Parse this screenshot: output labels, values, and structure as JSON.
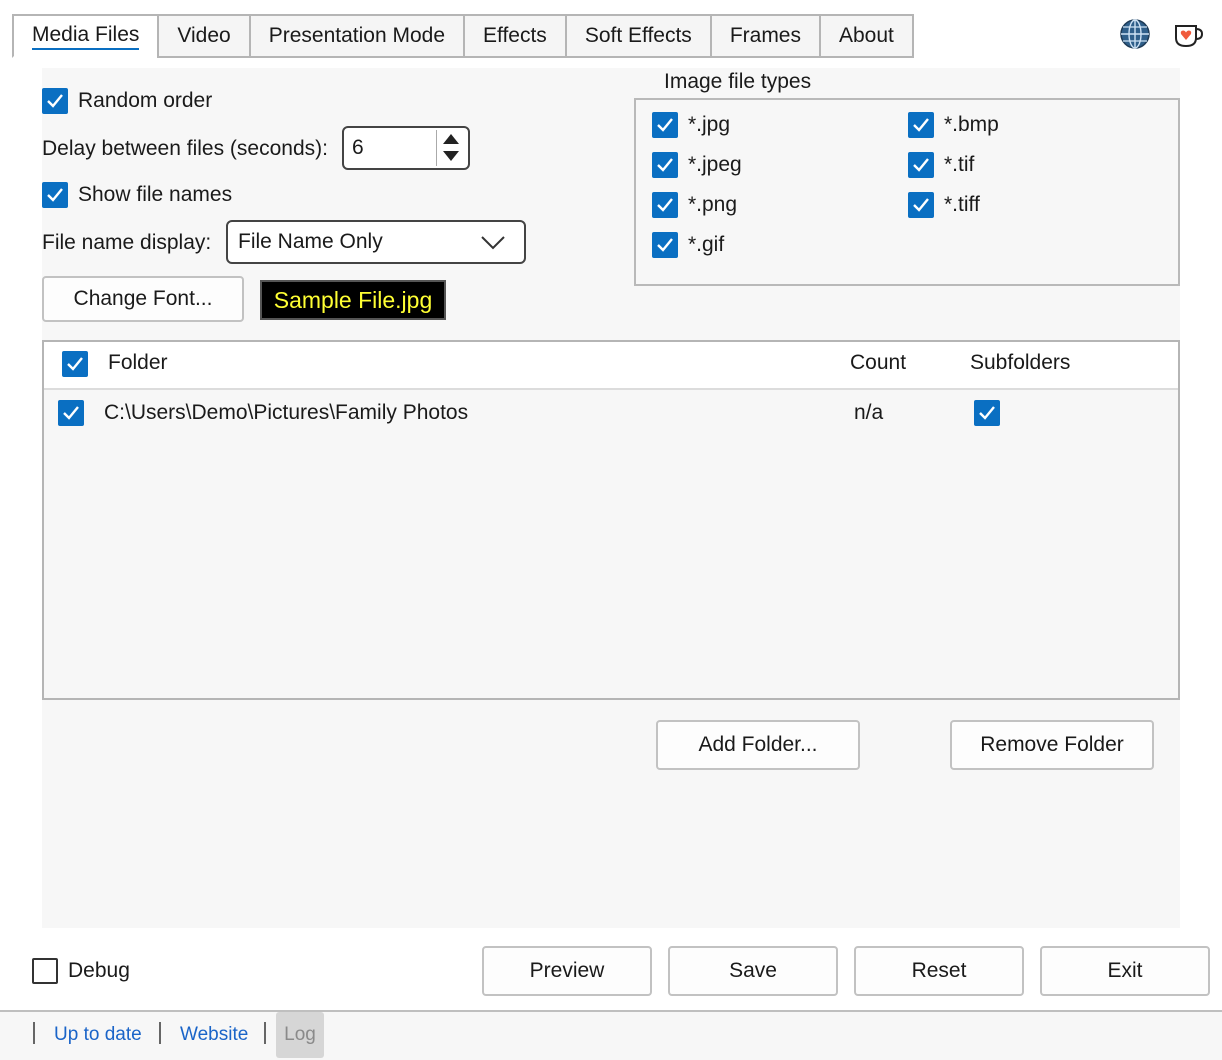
{
  "tabs": [
    {
      "label": "Media Files",
      "active": true
    },
    {
      "label": "Video"
    },
    {
      "label": "Presentation Mode"
    },
    {
      "label": "Effects"
    },
    {
      "label": "Soft Effects"
    },
    {
      "label": "Frames"
    },
    {
      "label": "About"
    }
  ],
  "toolbar_icons": [
    "globe-icon",
    "coffee-cup-icon"
  ],
  "options": {
    "random_order": {
      "label": "Random order",
      "checked": true
    },
    "delay": {
      "label": "Delay between files (seconds):",
      "value": "6"
    },
    "show_file_names": {
      "label": "Show file names",
      "checked": true
    },
    "file_name_display": {
      "label": "File name display:",
      "value": "File Name Only"
    },
    "change_font_label": "Change Font...",
    "sample_text": "Sample File.jpg",
    "sample_colors": {
      "background": "#000000",
      "text": "#ffff33"
    }
  },
  "file_types": {
    "title": "Image file types",
    "items": [
      {
        "label": "*.jpg",
        "checked": true
      },
      {
        "label": "*.jpeg",
        "checked": true
      },
      {
        "label": "*.png",
        "checked": true
      },
      {
        "label": "*.gif",
        "checked": true
      },
      {
        "label": "*.bmp",
        "checked": true
      },
      {
        "label": "*.tif",
        "checked": true
      },
      {
        "label": "*.tiff",
        "checked": true
      }
    ]
  },
  "folders": {
    "columns": [
      "Folder",
      "Count",
      "Subfolders"
    ],
    "rows": [
      {
        "path": "C:\\Users\\Demo\\Pictures\\Family Photos",
        "count": "n/a",
        "checked": true,
        "subfolders": true
      }
    ]
  },
  "folder_buttons": {
    "add": "Add Folder...",
    "remove": "Remove Folder"
  },
  "footer": {
    "debug": {
      "label": "Debug",
      "checked": false
    },
    "buttons": {
      "preview": "Preview",
      "save": "Save",
      "reset": "Reset",
      "exit": "Exit"
    }
  },
  "status": {
    "up_to_date": "Up to date",
    "website": "Website",
    "log": "Log"
  },
  "colors": {
    "accent": "#0a6fc2",
    "link": "#1a64c8"
  }
}
